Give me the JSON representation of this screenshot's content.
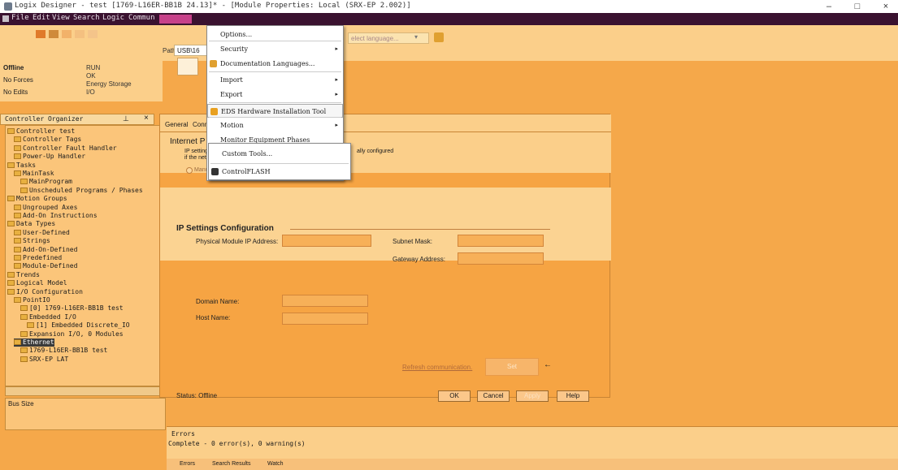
{
  "window": {
    "title": "Logix Designer - test [1769-L16ER-BB1B 24.13]* - [Module Properties: Local (SRX-EP 2.002)]",
    "minimize": "–",
    "maximize": "□",
    "close": "×"
  },
  "menubar": {
    "items": [
      "File",
      "Edit",
      "View",
      "Search",
      "Logic",
      "Commun"
    ]
  },
  "toolbar": {
    "path_label": "Path:",
    "path_value": "USB\\16",
    "language_placeholder": "elect language...",
    "language_chevron": "▾"
  },
  "controller_status": {
    "mode": "Offline",
    "forces": "No Forces",
    "edits": "No Edits",
    "checks": [
      "RUN",
      "OK",
      "Energy Storage",
      "I/O"
    ]
  },
  "organizer": {
    "title": "Controller Organizer",
    "pin": "⊥",
    "close": "×",
    "tree": [
      {
        "label": "Controller test",
        "indent": 0,
        "selected": false
      },
      {
        "label": "Controller Tags",
        "indent": 1,
        "selected": false
      },
      {
        "label": "Controller Fault Handler",
        "indent": 1,
        "selected": false
      },
      {
        "label": "Power-Up Handler",
        "indent": 1,
        "selected": false
      },
      {
        "label": "Tasks",
        "indent": 0,
        "selected": false
      },
      {
        "label": "MainTask",
        "indent": 1,
        "selected": false
      },
      {
        "label": "MainProgram",
        "indent": 2,
        "selected": false
      },
      {
        "label": "Unscheduled Programs / Phases",
        "indent": 2,
        "selected": false
      },
      {
        "label": "Motion Groups",
        "indent": 0,
        "selected": false
      },
      {
        "label": "Ungrouped Axes",
        "indent": 1,
        "selected": false
      },
      {
        "label": "Add-On Instructions",
        "indent": 1,
        "selected": false
      },
      {
        "label": "Data Types",
        "indent": 0,
        "selected": false
      },
      {
        "label": "User-Defined",
        "indent": 1,
        "selected": false
      },
      {
        "label": "Strings",
        "indent": 1,
        "selected": false
      },
      {
        "label": "Add-On-Defined",
        "indent": 1,
        "selected": false
      },
      {
        "label": "Predefined",
        "indent": 1,
        "selected": false
      },
      {
        "label": "Module-Defined",
        "indent": 1,
        "selected": false
      },
      {
        "label": "Trends",
        "indent": 0,
        "selected": false
      },
      {
        "label": "Logical Model",
        "indent": 0,
        "selected": false
      },
      {
        "label": "I/O Configuration",
        "indent": 0,
        "selected": false
      },
      {
        "label": "PointIO",
        "indent": 1,
        "selected": false
      },
      {
        "label": "[0] 1769-L16ER-BB1B test",
        "indent": 2,
        "selected": false
      },
      {
        "label": "Embedded I/O",
        "indent": 2,
        "selected": false
      },
      {
        "label": "[1] Embedded Discrete_IO",
        "indent": 3,
        "selected": false
      },
      {
        "label": "Expansion I/O, 0 Modules",
        "indent": 2,
        "selected": false
      },
      {
        "label": "Ethernet",
        "indent": 1,
        "selected": true
      },
      {
        "label": "1769-L16ER-BB1B test",
        "indent": 2,
        "selected": false
      },
      {
        "label": "SRX-EP LAT",
        "indent": 2,
        "selected": false
      }
    ],
    "property_label": "Bus Size"
  },
  "dialog": {
    "tabs": [
      "General",
      "Conn"
    ],
    "section_title": "Internet P",
    "ip_note_1": "IP settings",
    "ip_note_2": "if the netw",
    "ip_note_tail": "ally configured",
    "manual_radio": "Manua",
    "ip_section": "IP Settings Configuration",
    "physical_ip_label": "Physical Module IP Address:",
    "subnet_label": "Subnet Mask:",
    "gateway_label": "Gateway Address:",
    "ip_placeholder": ".   .   .",
    "domain_label": "Domain Name:",
    "host_label": "Host Name:",
    "refresh_link": "Refresh communication.",
    "set_button": "Set",
    "status": "Status: Offline",
    "ok": "OK",
    "cancel": "Cancel",
    "apply": "Apply",
    "help": "Help"
  },
  "tools_menu": {
    "items": [
      {
        "label": "Options...",
        "arrow": false,
        "icon": false
      },
      {
        "label": "Security",
        "arrow": true,
        "icon": false
      },
      {
        "label": "Documentation Languages...",
        "arrow": false,
        "icon": true
      },
      {
        "label": "Import",
        "arrow": true,
        "icon": false
      },
      {
        "label": "Export",
        "arrow": true,
        "icon": false
      },
      {
        "label": "EDS Hardware Installation Tool",
        "arrow": false,
        "icon": true
      },
      {
        "label": "Motion",
        "arrow": true,
        "icon": false
      },
      {
        "label": "Monitor Equipment Phases",
        "arrow": false,
        "icon": false
      }
    ],
    "flyout_items": [
      {
        "label": "Custom Tools..."
      },
      {
        "label": "ControlFLASH"
      }
    ]
  },
  "errors_panel": {
    "title": "Errors",
    "message": "Complete - 0 error(s), 0 warning(s)",
    "tabs": [
      "Errors",
      "Search Results",
      "Watch"
    ]
  },
  "colors": {
    "background": "#f5a84a",
    "panel": "#fbcf8a",
    "menubar": "#3a1230",
    "selected": "#3a3a3a"
  }
}
